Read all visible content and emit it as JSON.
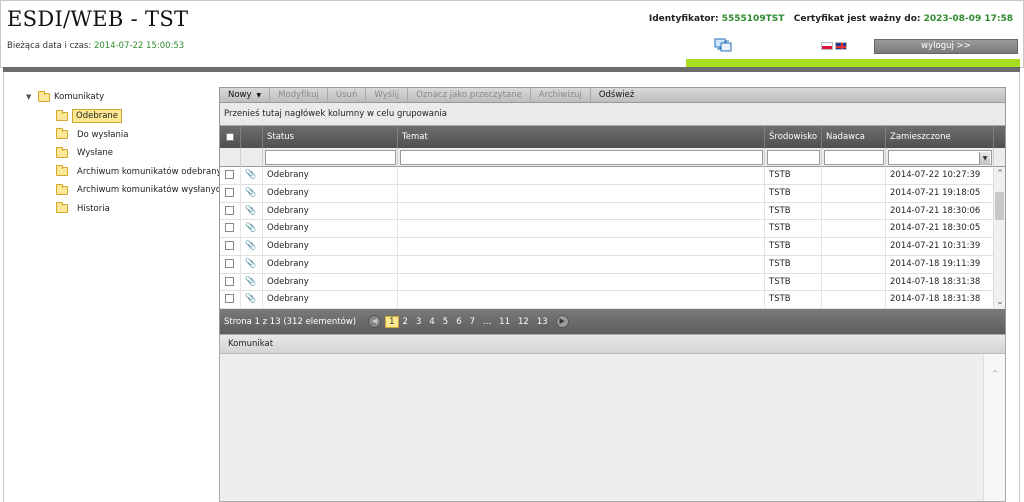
{
  "header": {
    "app_title": "ESDI/WEB - TST",
    "datetime_label": "Bieżąca data i czas:",
    "datetime_value": "2014-07-22 15:00:53",
    "ident_label": "Identyfikator:",
    "ident_value": "5555109TST",
    "cert_label": "Certyfikat jest ważny do:",
    "cert_value": "2023-08-09 17:58",
    "logout_label": "wyloguj >>",
    "icons": [
      "sync-icon",
      "flag-pl-icon",
      "flag-gb-icon"
    ]
  },
  "tree": {
    "root": "Komunikaty",
    "items": [
      {
        "label": "Odebrane"
      },
      {
        "label": "Do wysłania"
      },
      {
        "label": "Wysłane"
      },
      {
        "label": "Archiwum komunikatów odebranych"
      },
      {
        "label": "Archiwum komunikatów wysłanych"
      },
      {
        "label": "Historia"
      }
    ]
  },
  "toolbar": {
    "buttons": [
      "Nowy",
      "Modyfikuj",
      "Usuń",
      "Wyślij",
      "Oznacz jako przeczytane",
      "Archiwizuj",
      "Odśwież"
    ]
  },
  "grid": {
    "group_hint": "Przenieś tutaj nagłówek kolumny w celu grupowania",
    "columns": [
      "Status",
      "Temat",
      "Środowisko",
      "Nadawca",
      "Zamieszczone"
    ],
    "rows": [
      {
        "status": "Odebrany",
        "temat": "",
        "srodowisko": "TSTB",
        "nadawca": "",
        "zamieszczone": "2014-07-22 10:27:39"
      },
      {
        "status": "Odebrany",
        "temat": "",
        "srodowisko": "TSTB",
        "nadawca": "",
        "zamieszczone": "2014-07-21 19:18:05"
      },
      {
        "status": "Odebrany",
        "temat": "",
        "srodowisko": "TSTB",
        "nadawca": "",
        "zamieszczone": "2014-07-21 18:30:06"
      },
      {
        "status": "Odebrany",
        "temat": "",
        "srodowisko": "TSTB",
        "nadawca": "",
        "zamieszczone": "2014-07-21 18:30:05"
      },
      {
        "status": "Odebrany",
        "temat": "",
        "srodowisko": "TSTB",
        "nadawca": "",
        "zamieszczone": "2014-07-21 10:31:39"
      },
      {
        "status": "Odebrany",
        "temat": "",
        "srodowisko": "TSTB",
        "nadawca": "",
        "zamieszczone": "2014-07-18 19:11:39"
      },
      {
        "status": "Odebrany",
        "temat": "",
        "srodowisko": "TSTB",
        "nadawca": "",
        "zamieszczone": "2014-07-18 18:31:38"
      },
      {
        "status": "Odebrany",
        "temat": "",
        "srodowisko": "TSTB",
        "nadawca": "",
        "zamieszczone": "2014-07-18 18:31:38"
      }
    ]
  },
  "pager": {
    "info": "Strona 1 z 13 (312 elementów)",
    "pages": [
      "1",
      "2",
      "3",
      "4",
      "5",
      "6",
      "7",
      "...",
      "11",
      "12",
      "13"
    ],
    "current": "1"
  },
  "detail": {
    "title": "Komunikat"
  },
  "colors": {
    "accent_green": "#aadd22",
    "value_green": "#2e8b2e",
    "selection_yellow": "#fee890"
  }
}
